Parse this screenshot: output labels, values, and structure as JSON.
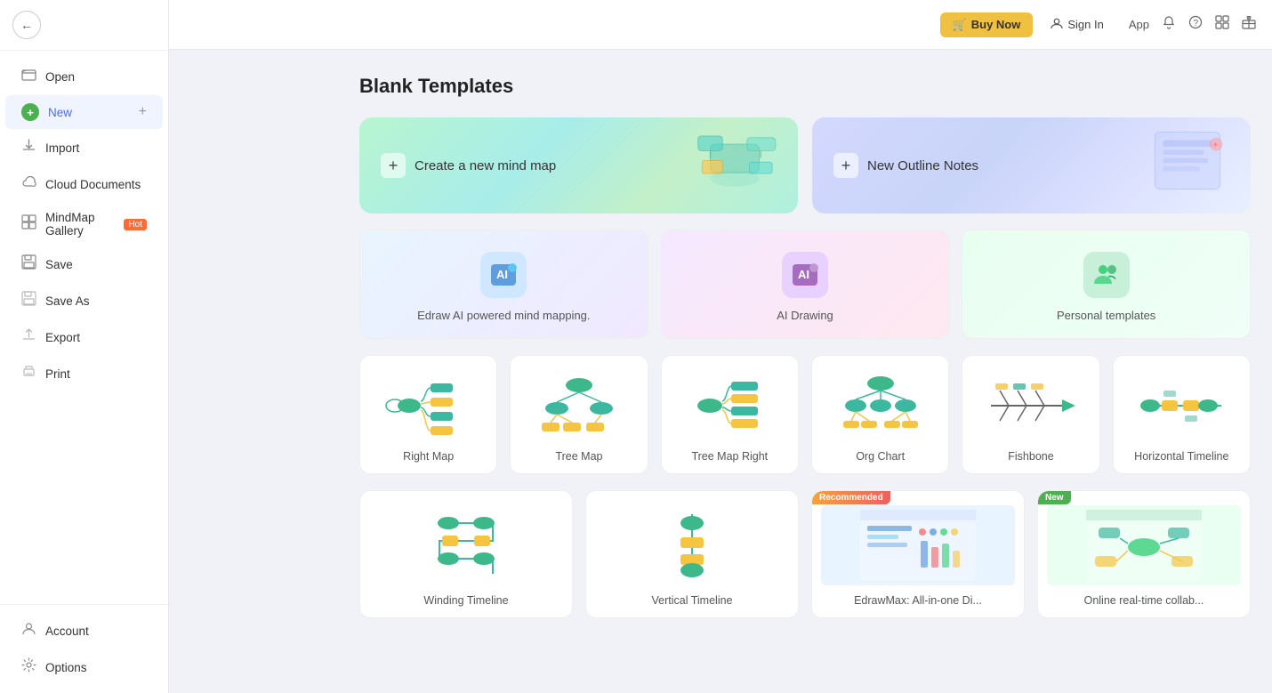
{
  "sidebar": {
    "back_label": "←",
    "items": [
      {
        "id": "open",
        "label": "Open",
        "icon": "📁"
      },
      {
        "id": "new",
        "label": "New",
        "icon": "+",
        "extra": "+"
      },
      {
        "id": "import",
        "label": "Import",
        "icon": "📥"
      },
      {
        "id": "cloud",
        "label": "Cloud Documents",
        "icon": "☁️"
      },
      {
        "id": "gallery",
        "label": "MindMap Gallery",
        "icon": "💬",
        "badge": "Hot"
      },
      {
        "id": "save",
        "label": "Save",
        "icon": "💾"
      },
      {
        "id": "saveas",
        "label": "Save As",
        "icon": "📋"
      },
      {
        "id": "export",
        "label": "Export",
        "icon": "📤"
      },
      {
        "id": "print",
        "label": "Print",
        "icon": "🖨️"
      }
    ],
    "bottom_items": [
      {
        "id": "account",
        "label": "Account",
        "icon": "👤"
      },
      {
        "id": "options",
        "label": "Options",
        "icon": "⚙️"
      }
    ]
  },
  "topbar": {
    "buy_now": "Buy Now",
    "sign_in": "Sign In",
    "app_label": "App"
  },
  "main": {
    "title": "Blank Templates",
    "hero": [
      {
        "id": "new-mind-map",
        "label": "Create a new mind map",
        "bg": "green"
      },
      {
        "id": "new-outline",
        "label": "New Outline Notes",
        "bg": "blue"
      }
    ],
    "features": [
      {
        "id": "ai-mind",
        "label": "Edraw AI powered mind mapping.",
        "icon": "🤖",
        "bg": "#e8f4ff"
      },
      {
        "id": "ai-drawing",
        "label": "AI Drawing",
        "icon": "🎨",
        "bg": "#f5e8ff"
      },
      {
        "id": "personal-templates",
        "label": "Personal templates",
        "icon": "👥",
        "bg": "#e8ffe8"
      }
    ],
    "templates": [
      {
        "id": "right-map",
        "label": "Right Map"
      },
      {
        "id": "tree-map",
        "label": "Tree Map"
      },
      {
        "id": "tree-map-right",
        "label": "Tree Map Right"
      },
      {
        "id": "org-chart",
        "label": "Org Chart"
      },
      {
        "id": "fishbone",
        "label": "Fishbone"
      },
      {
        "id": "horizontal-timeline",
        "label": "Horizontal Timeline"
      }
    ],
    "bottom_templates": [
      {
        "id": "winding-timeline",
        "label": "Winding Timeline",
        "badge": ""
      },
      {
        "id": "vertical-timeline",
        "label": "Vertical Timeline",
        "badge": ""
      },
      {
        "id": "edrawmax",
        "label": "EdrawMax: All-in-one Di...",
        "badge": "Recommended"
      },
      {
        "id": "online-collab",
        "label": "Online real-time collab...",
        "badge": "New"
      }
    ]
  }
}
